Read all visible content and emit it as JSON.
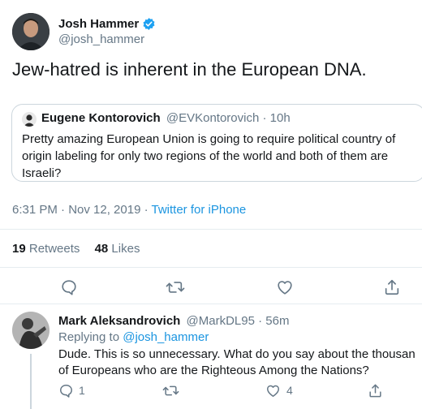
{
  "tweet": {
    "author_name": "Josh Hammer",
    "author_handle": "@josh_hammer",
    "text": "Jew-hatred is inherent in the European DNA.",
    "timestamp": "6:31 PM · Nov 12, 2019",
    "source_sep": " · ",
    "source": "Twitter for iPhone",
    "stats": {
      "retweets_count": "19",
      "retweets_label": "Retweets",
      "likes_count": "48",
      "likes_label": "Likes"
    }
  },
  "quoted": {
    "author_name": "Eugene Kontorovich",
    "author_handle": "@EVKontorovich · 10h",
    "text_line1": "Pretty amazing European Union is going to require political  country of",
    "text_line2": "origin labeling for only two regions of the world and both of them are",
    "text_line3": "Israeli?"
  },
  "reply": {
    "author_name": "Mark Aleksandrovich",
    "author_handle": "@MarkDL95 · 56m",
    "replying_prefix": "Replying to",
    "replying_to": "@josh_hammer",
    "text_line1": "Dude. This is so unnecessary. What do you say about the thousan",
    "text_line2": "of Europeans who are the Righteous Among the Nations?",
    "reply_count": "1",
    "like_count": "4"
  },
  "colors": {
    "verified": "#1da1f2",
    "link": "#1b95e0",
    "muted": "#657786",
    "divider": "#e6ecf0"
  },
  "icons": [
    "verified-badge-icon",
    "reply-icon",
    "retweet-icon",
    "like-icon",
    "share-icon"
  ]
}
